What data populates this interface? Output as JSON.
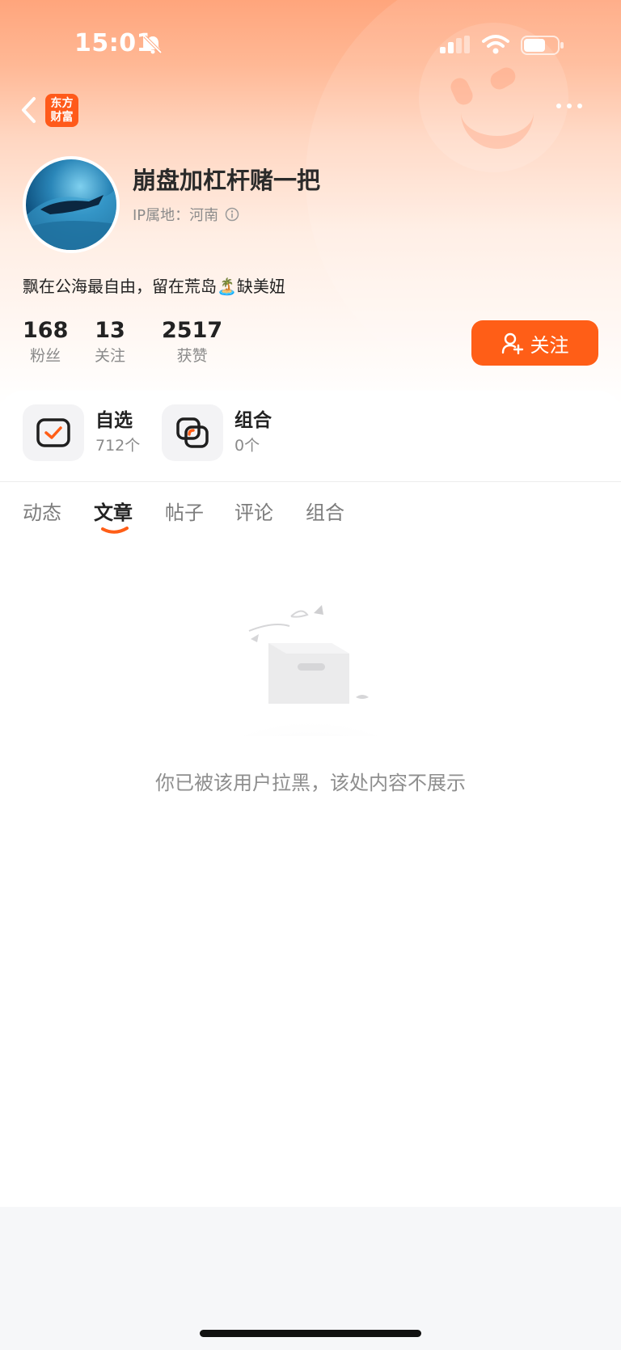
{
  "status_bar": {
    "time": "15:01"
  },
  "header": {
    "logo_line1": "东方",
    "logo_line2": "财富"
  },
  "profile": {
    "username": "崩盘加杠杆赌一把",
    "ip_location": "IP属地：河南",
    "bio": "飘在公海最自由，留在荒岛🏝️缺美妞"
  },
  "stats": [
    {
      "value": "168",
      "label": "粉丝"
    },
    {
      "value": "13",
      "label": "关注"
    },
    {
      "value": "2517",
      "label": "获赞"
    }
  ],
  "follow_button": {
    "label": "关注"
  },
  "shortcuts": [
    {
      "title": "自选",
      "count": "712个"
    },
    {
      "title": "组合",
      "count": "0个"
    }
  ],
  "tabs": [
    {
      "label": "动态"
    },
    {
      "label": "文章"
    },
    {
      "label": "帖子"
    },
    {
      "label": "评论"
    },
    {
      "label": "组合"
    }
  ],
  "active_tab": "文章",
  "empty_state": {
    "message": "你已被该用户拉黑，该处内容不展示"
  },
  "colors": {
    "accent": "#ff5e17",
    "header_gradient_top": "#ffa57c"
  }
}
